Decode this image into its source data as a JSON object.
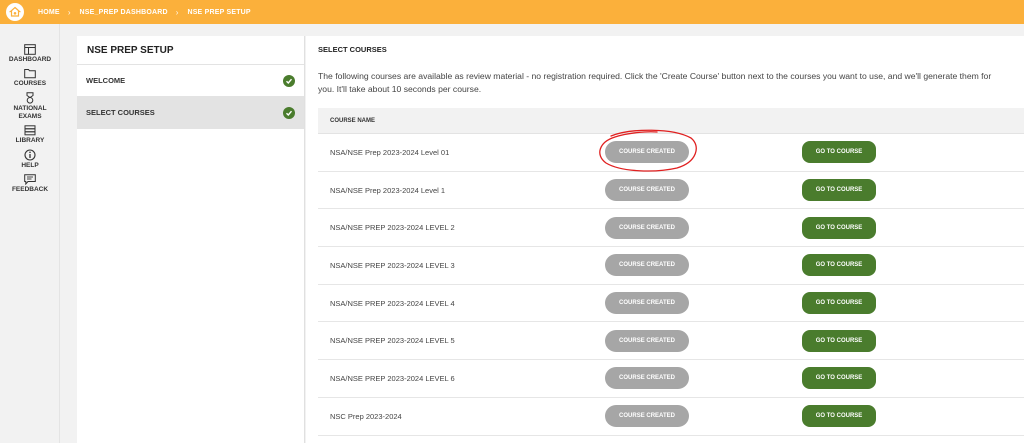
{
  "breadcrumb": {
    "items": [
      "HOME",
      "NSE_PREP DASHBOARD",
      "NSE PREP SETUP"
    ],
    "separator": "›"
  },
  "sidebar": {
    "items": [
      {
        "label": "DASHBOARD",
        "icon": "dashboard-icon"
      },
      {
        "label": "COURSES",
        "icon": "folder-icon"
      },
      {
        "label": "NATIONAL EXAMS",
        "icon": "medal-icon"
      },
      {
        "label": "LIBRARY",
        "icon": "library-icon"
      },
      {
        "label": "HELP",
        "icon": "info-icon"
      },
      {
        "label": "FEEDBACK",
        "icon": "feedback-icon"
      }
    ]
  },
  "setup": {
    "title": "NSE PREP SETUP",
    "steps": [
      {
        "label": "WELCOME",
        "completed": true,
        "active": false
      },
      {
        "label": "SELECT COURSES",
        "completed": true,
        "active": true
      }
    ]
  },
  "main": {
    "title": "SELECT COURSES",
    "description": "The following courses are available as review material - no registration required. Click the 'Create Course' button next to the courses you want to use, and we'll generate them for you. It'll take about 10 seconds per course.",
    "column_header": "COURSE NAME",
    "rows": [
      {
        "name": "NSA/NSE Prep 2023-2024 Level 01",
        "status": "COURSE CREATED",
        "action": "GO TO COURSE"
      },
      {
        "name": "NSA/NSE Prep 2023-2024 Level 1",
        "status": "COURSE CREATED",
        "action": "GO TO COURSE"
      },
      {
        "name": "NSA/NSE PREP 2023-2024 LEVEL 2",
        "status": "COURSE CREATED",
        "action": "GO TO COURSE"
      },
      {
        "name": "NSA/NSE PREP 2023-2024 LEVEL 3",
        "status": "COURSE CREATED",
        "action": "GO TO COURSE"
      },
      {
        "name": "NSA/NSE PREP 2023-2024 LEVEL 4",
        "status": "COURSE CREATED",
        "action": "GO TO COURSE"
      },
      {
        "name": "NSA/NSE PREP 2023-2024 LEVEL 5",
        "status": "COURSE CREATED",
        "action": "GO TO COURSE"
      },
      {
        "name": "NSA/NSE PREP 2023-2024 LEVEL 6",
        "status": "COURSE CREATED",
        "action": "GO TO COURSE"
      },
      {
        "name": "NSC Prep 2023-2024",
        "status": "COURSE CREATED",
        "action": "GO TO COURSE"
      }
    ]
  },
  "colors": {
    "topbar": "#fbb03b",
    "go_button": "#4a7c2d",
    "created_button": "#a6a6a6",
    "annotation": "#e02020"
  }
}
